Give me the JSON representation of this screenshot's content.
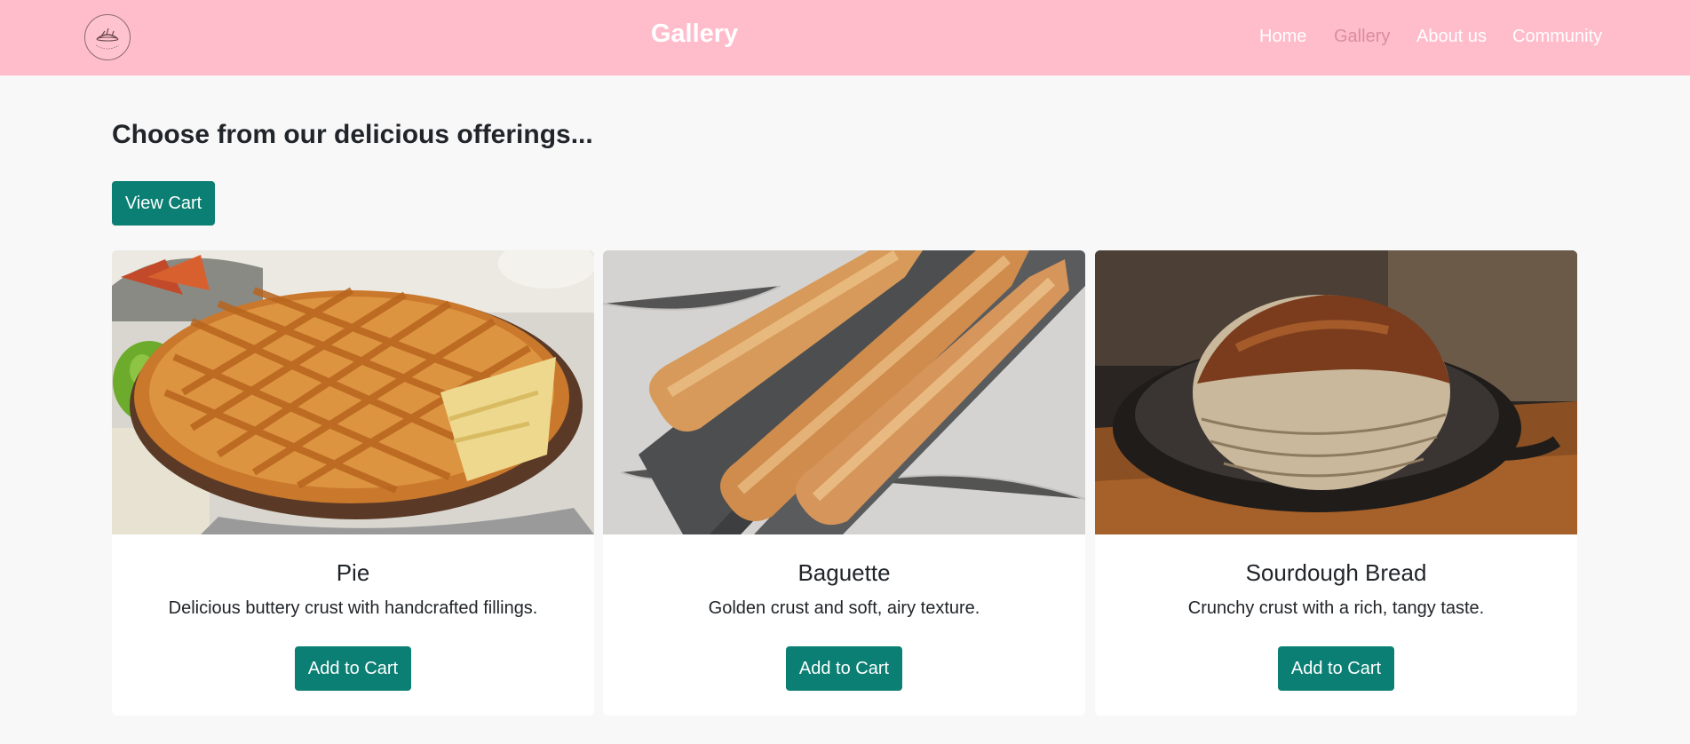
{
  "navbar": {
    "logo_icon": "bakery-logo-icon",
    "title": "Gallery",
    "links": [
      {
        "label": "Home",
        "active": false
      },
      {
        "label": "Gallery",
        "active": true
      },
      {
        "label": "About us",
        "active": false
      },
      {
        "label": "Community",
        "active": false
      }
    ]
  },
  "main": {
    "heading": "Choose from our delicious offerings...",
    "view_cart_label": "View Cart"
  },
  "products": [
    {
      "name": "Pie",
      "description": "Delicious buttery crust with handcrafted fillings.",
      "button_label": "Add to Cart",
      "image": "apple-pie-photo"
    },
    {
      "name": "Baguette",
      "description": "Golden crust and soft, airy texture.",
      "button_label": "Add to Cart",
      "image": "baguettes-photo"
    },
    {
      "name": "Sourdough Bread",
      "description": "Crunchy crust with a rich, tangy taste.",
      "button_label": "Add to Cart",
      "image": "sourdough-bread-photo"
    }
  ],
  "colors": {
    "navbar_bg": "#ffbccb",
    "active_link": "#d98ea0",
    "button_bg": "#0b7f73",
    "page_bg": "#f8f8f8"
  }
}
